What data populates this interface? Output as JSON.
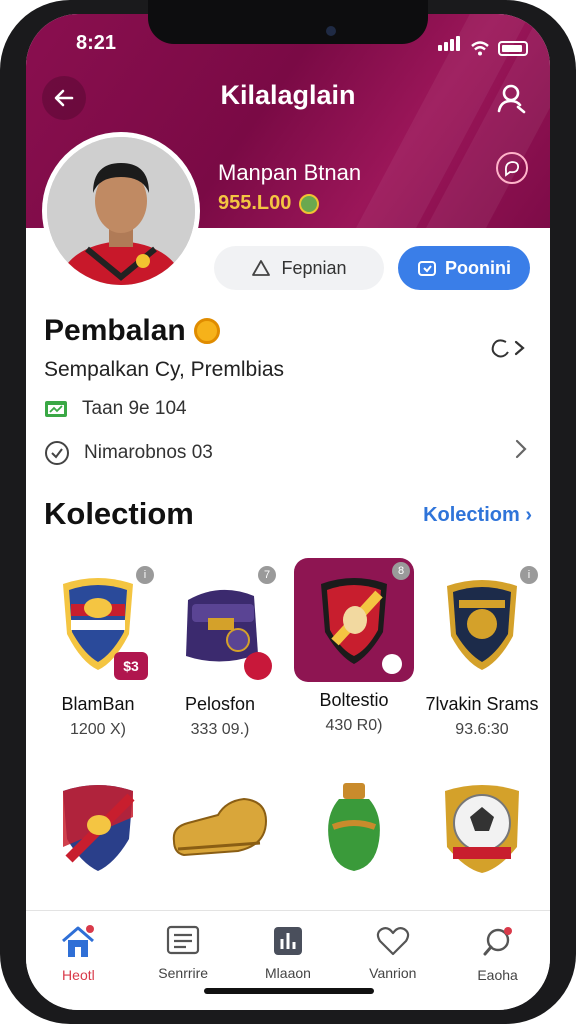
{
  "status": {
    "time": "8:21"
  },
  "header": {
    "title": "Kilalaglain",
    "user_name": "Manpan Btnan",
    "user_coins": "955.L00"
  },
  "actions": {
    "secondary_label": "Fepnian",
    "primary_label": "Poonini"
  },
  "section": {
    "title": "Pembalan",
    "subtitle": "Sempalkan Cy, Premlbias",
    "rows": [
      {
        "label": "Taan 9e 104"
      },
      {
        "label": "Nimarobnos 03"
      }
    ]
  },
  "collection": {
    "title": "Kolectiom",
    "link_label": "Kolectiom",
    "items": [
      {
        "name": "BlamBan",
        "price": "1200 X)",
        "badge": "i"
      },
      {
        "name": "Pelosfon",
        "price": "333 09.)",
        "badge": "7"
      },
      {
        "name": "Boltestio",
        "price": "430 R0)",
        "badge": "8"
      },
      {
        "name": "7lvakin Srams",
        "price": "93.6:30",
        "badge": "i"
      }
    ],
    "items_row2": [
      "shield-flag",
      "golden-shoe",
      "green-vase",
      "football-trophy"
    ]
  },
  "nav": {
    "items": [
      {
        "label": "Heotl",
        "icon": "home-icon",
        "active": true
      },
      {
        "label": "Senrrire",
        "icon": "list-icon",
        "active": false
      },
      {
        "label": "Mlaaon",
        "icon": "chart-icon",
        "active": false
      },
      {
        "label": "Vanrion",
        "icon": "heart-icon",
        "active": false
      },
      {
        "label": "Eaoha",
        "icon": "search-icon",
        "active": false
      }
    ]
  },
  "colors": {
    "brand": "#8a0f4f",
    "primary_button": "#3a7ee8",
    "link": "#2f74d9",
    "nav_active": "#d93a4a"
  }
}
